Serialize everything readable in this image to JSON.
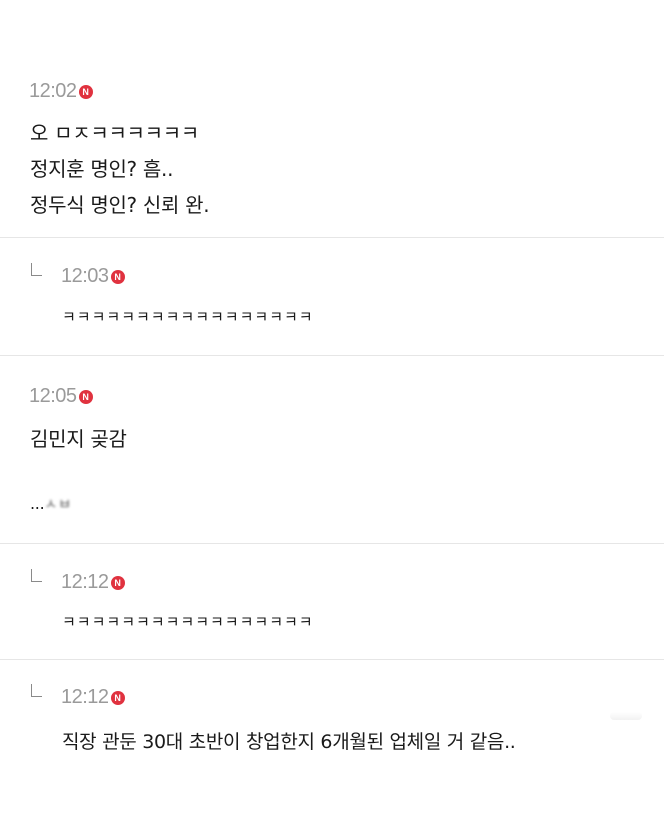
{
  "comments": [
    {
      "time": "12:02",
      "badge": "N",
      "lines": [
        "오 ㅁㅈㅋㅋㅋㅋㅋㅋ",
        "정지훈 명인? 흠..",
        "정두식 명인? 신뢰 완."
      ]
    },
    {
      "time": "12:03",
      "badge": "N",
      "lines": [
        "ㅋㅋㅋㅋㅋㅋㅋㅋㅋㅋㅋㅋㅋㅋㅋㅋㅋ"
      ]
    },
    {
      "time": "12:05",
      "badge": "N",
      "lines": [
        "김민지 곶감",
        "...",
        "ㅅㅂ"
      ]
    },
    {
      "time": "12:12",
      "badge": "N",
      "lines": [
        "ㅋㅋㅋㅋㅋㅋㅋㅋㅋㅋㅋㅋㅋㅋㅋㅋㅋ"
      ]
    },
    {
      "time": "12:12",
      "badge": "N",
      "lines": [
        "직장 관둔 30대 초반이 창업한지 6개월된 업체일 거 같음.."
      ]
    }
  ],
  "colors": {
    "badge": "#e0323f",
    "time": "#9a9a9a",
    "text": "#1a1a1a",
    "divider": "#e6e6e6"
  },
  "icons": {
    "badge": "new-badge-icon",
    "reply": "reply-arrow-icon"
  }
}
